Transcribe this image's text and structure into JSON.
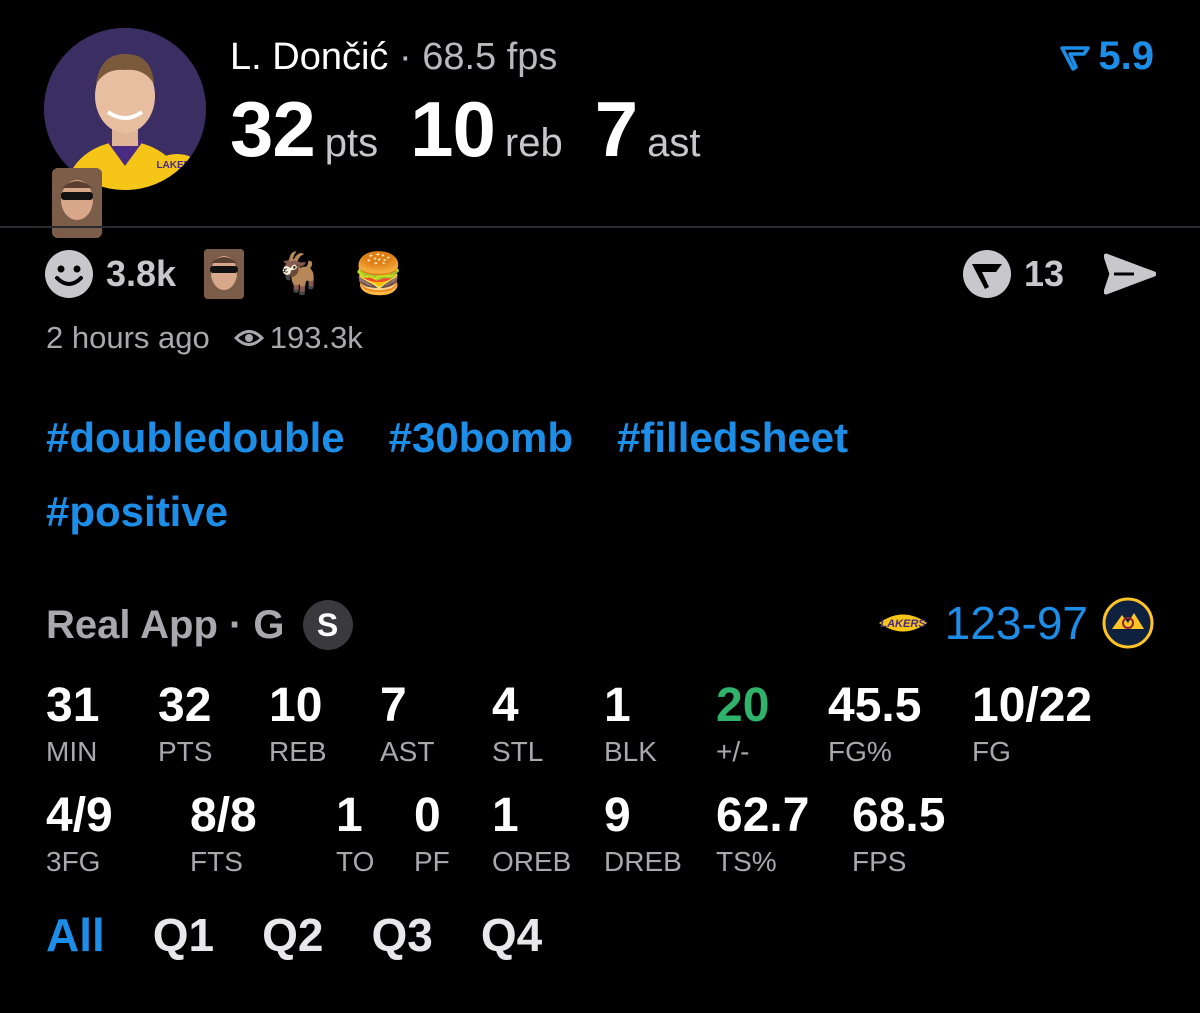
{
  "player": {
    "name": "L. Dončić",
    "separator": "·",
    "fps_label": "68.5 fps",
    "team": "Lakers"
  },
  "headline_stats": [
    {
      "value": "32",
      "unit": "pts"
    },
    {
      "value": "10",
      "unit": "reb"
    },
    {
      "value": "7",
      "unit": "ast"
    }
  ],
  "rating": {
    "value": "5.9",
    "icon": "rating-flag-icon",
    "color": "#1d8ee8"
  },
  "reactions": {
    "count": "3.8k",
    "icon": "smiley-icon",
    "emojis": [
      "🐐",
      "🍔"
    ]
  },
  "comments": {
    "count": "13",
    "icon": "comment-logo-icon",
    "share_icon": "send-icon"
  },
  "meta": {
    "time_ago": "2 hours ago",
    "views": "193.3k",
    "views_icon": "eye-icon"
  },
  "hashtags": [
    "#doubledouble",
    "#30bomb",
    "#filledsheet",
    "#positive"
  ],
  "game": {
    "source": "Real App · G",
    "badge": "S",
    "home_team": "Lakers",
    "home_abbr": "LAKERS",
    "away_team": "Nuggets",
    "score": "123-97"
  },
  "stats_row1": [
    {
      "value": "31",
      "label": "MIN"
    },
    {
      "value": "32",
      "label": "PTS"
    },
    {
      "value": "10",
      "label": "REB"
    },
    {
      "value": "7",
      "label": "AST"
    },
    {
      "value": "4",
      "label": "STL"
    },
    {
      "value": "1",
      "label": "BLK"
    },
    {
      "value": "20",
      "label": "+/-",
      "highlight": "#2fb36b"
    },
    {
      "value": "45.5",
      "label": "FG%"
    },
    {
      "value": "10/22",
      "label": "FG"
    }
  ],
  "stats_row2": [
    {
      "value": "4/9",
      "label": "3FG"
    },
    {
      "value": "8/8",
      "label": "FTS"
    },
    {
      "value": "1",
      "label": "TO"
    },
    {
      "value": "0",
      "label": "PF"
    },
    {
      "value": "1",
      "label": "OREB"
    },
    {
      "value": "9",
      "label": "DREB"
    },
    {
      "value": "62.7",
      "label": "TS%"
    },
    {
      "value": "68.5",
      "label": "FPS"
    }
  ],
  "quarter_tabs": [
    {
      "label": "All",
      "active": true
    },
    {
      "label": "Q1",
      "active": false
    },
    {
      "label": "Q2",
      "active": false
    },
    {
      "label": "Q3",
      "active": false
    },
    {
      "label": "Q4",
      "active": false
    }
  ],
  "colors": {
    "accent": "#1d8ee8",
    "positive": "#2fb36b",
    "muted": "#a8a8ad",
    "background": "#000000"
  }
}
